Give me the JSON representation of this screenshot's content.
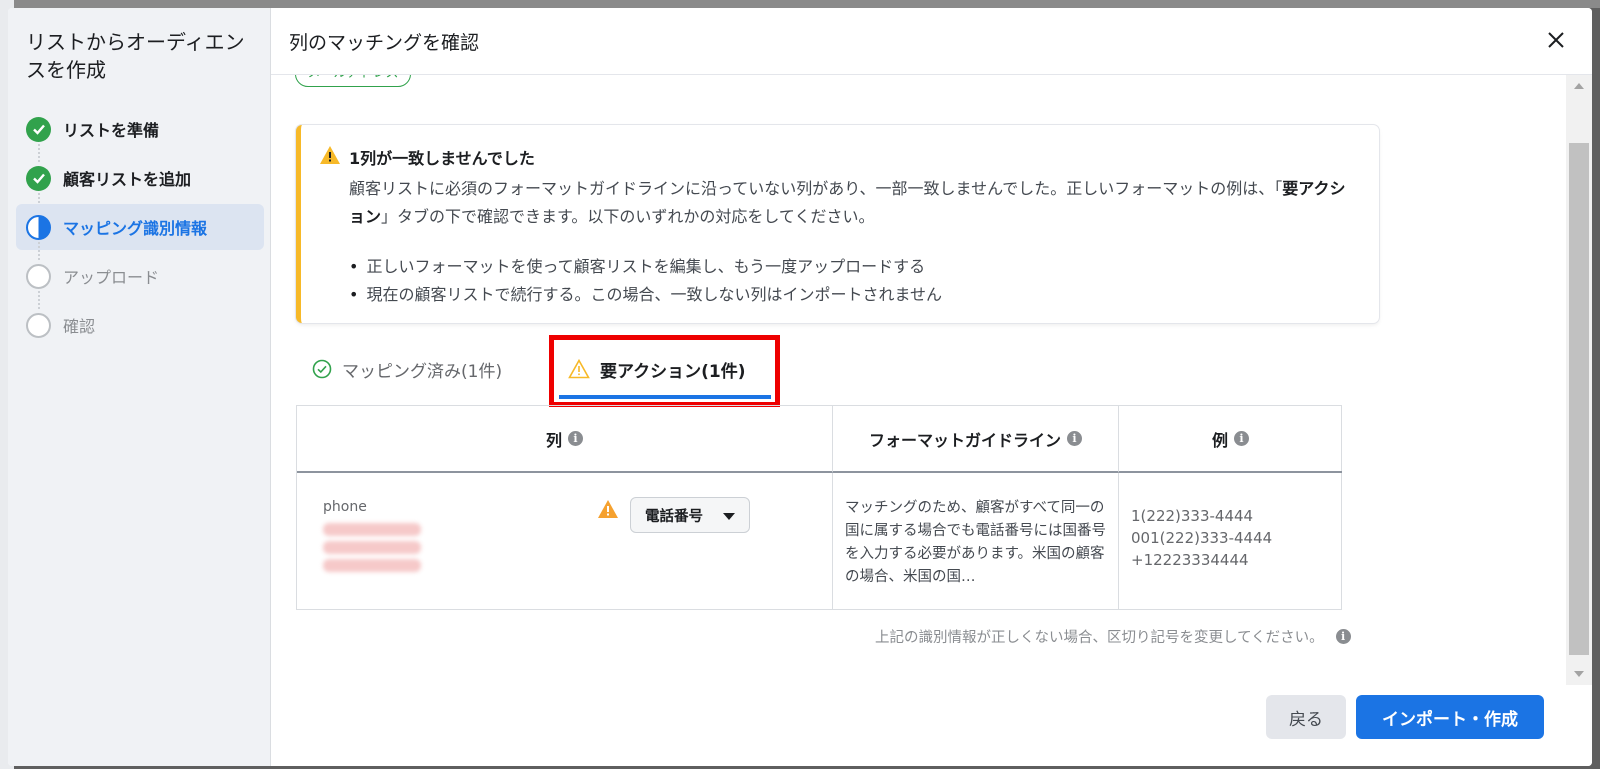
{
  "sidebar": {
    "title": "リストからオーディエンスを作成",
    "steps": [
      {
        "label": "リストを準備",
        "state": "done"
      },
      {
        "label": "顧客リストを追加",
        "state": "done"
      },
      {
        "label": "マッピング識別情報",
        "state": "active"
      },
      {
        "label": "アップロード",
        "state": "todo"
      },
      {
        "label": "確認",
        "state": "todo"
      }
    ]
  },
  "header": {
    "title": "列のマッチングを確認"
  },
  "chip": {
    "label": "メールアドレス"
  },
  "alert": {
    "title": "1列が一致しませんでした",
    "body_pre": "顧客リストに必須のフォーマットガイドラインに沿っていない列があり、一部一致しませんでした。正しいフォーマットの例は、「",
    "body_bold": "要アクション",
    "body_post": "」タブの下で確認できます。以下のいずれかの対応をしてください。",
    "bullets": [
      "正しいフォーマットを使って顧客リストを編集し、もう一度アップロードする",
      "現在の顧客リストで続行する。この場合、一致しない列はインポートされません"
    ]
  },
  "tabs": [
    {
      "label": "マッピング済み(1件)",
      "icon": "check-circle-icon"
    },
    {
      "label": "要アクション(1件)",
      "icon": "warning-icon"
    }
  ],
  "table": {
    "headers": {
      "column": "列",
      "format": "フォーマットガイドライン",
      "example": "例"
    },
    "row": {
      "column_name": "phone",
      "mapping": "電話番号",
      "guideline": "マッチングのため、顧客がすべて同一の国に属する場合でも電話番号には国番号を入力する必要があります。米国の顧客の場合、米国の国…",
      "examples": [
        "1(222)333-4444",
        "001(222)333-4444",
        "+12223334444"
      ]
    }
  },
  "footnote": "上記の識別情報が正しくない場合、区切り記号を変更してください。",
  "footer": {
    "back": "戻る",
    "primary": "インポート・作成"
  },
  "colors": {
    "accent": "#1b74e4",
    "success": "#31a24c",
    "warning": "#f7b928",
    "highlight": "#ee0000"
  }
}
